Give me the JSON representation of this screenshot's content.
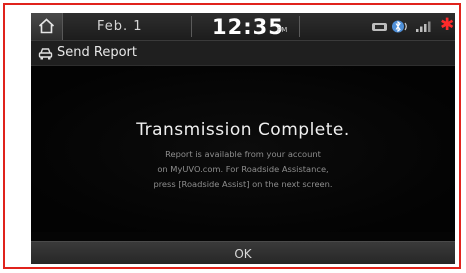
{
  "status_bar": {
    "date": "Feb. 1",
    "time": "12:35",
    "ampm": "PM",
    "icons": [
      "home-icon",
      "media-icon",
      "bluetooth-icon",
      "signal-icon",
      "alert-star-icon"
    ],
    "alert_color": "#ff2a2a"
  },
  "title_bar": {
    "title": "Send Report",
    "icon": "car-icon"
  },
  "dialog": {
    "headline": "Transmission Complete.",
    "lines": [
      "Report is available from your account",
      "on MyUVO.com. For Roadside Assistance,",
      "press [Roadside Assist] on the next screen."
    ]
  },
  "ok_button": {
    "label": "OK"
  },
  "colors": {
    "frame_border": "#e0231c",
    "screen_bg": "#050505"
  }
}
